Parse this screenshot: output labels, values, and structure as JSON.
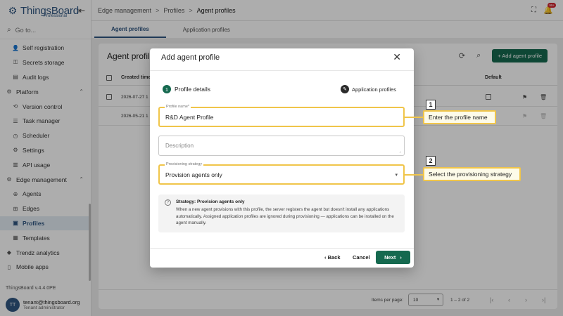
{
  "brand": {
    "name": "ThingsBoard",
    "sub": "Professional"
  },
  "search": {
    "placeholder": "Go to..."
  },
  "sidebar": {
    "items": [
      {
        "label": "Self registration",
        "icon": "person-add-icon"
      },
      {
        "label": "Secrets storage",
        "icon": "key-icon"
      },
      {
        "label": "Audit logs",
        "icon": "audit-icon"
      },
      {
        "label": "Platform",
        "icon": "platform-icon",
        "section": true,
        "expanded": true
      },
      {
        "label": "Version control",
        "icon": "history-icon"
      },
      {
        "label": "Task manager",
        "icon": "list-icon"
      },
      {
        "label": "Scheduler",
        "icon": "clock-icon"
      },
      {
        "label": "Settings",
        "icon": "gear-icon"
      },
      {
        "label": "API usage",
        "icon": "chart-icon"
      },
      {
        "label": "Edge management",
        "icon": "edge-icon",
        "section": true,
        "expanded": true
      },
      {
        "label": "Agents",
        "icon": "globe-icon"
      },
      {
        "label": "Edges",
        "icon": "edges-icon"
      },
      {
        "label": "Profiles",
        "icon": "profile-icon",
        "active": true
      },
      {
        "label": "Templates",
        "icon": "template-icon"
      },
      {
        "label": "Trendz analytics",
        "icon": "trendz-icon",
        "section": true
      },
      {
        "label": "Mobile apps",
        "icon": "mobile-icon",
        "section": true
      }
    ],
    "version": "ThingsBoard v.4.4.0PE",
    "user": {
      "initials": "TT",
      "email": "tenant@thingsboard.org",
      "role": "Tenant administrator"
    }
  },
  "breadcrumb": [
    "Edge management",
    "Profiles",
    "Agent profiles"
  ],
  "notifications_badge": "99+",
  "tabs": [
    "Agent profiles",
    "Application profiles"
  ],
  "table": {
    "title": "Agent profiles",
    "add_label": "+ Add agent profile",
    "headers": {
      "created": "Created time",
      "default": "Default"
    },
    "rows": [
      {
        "created": "2026-07-27 1"
      },
      {
        "created": "2026-05-21 1"
      }
    ],
    "items_per_page_label": "Items per page:",
    "items_per_page": "10",
    "range": "1 – 2 of 2"
  },
  "dialog": {
    "title": "Add agent profile",
    "step1": {
      "num": "1",
      "label": "Profile details"
    },
    "step2": {
      "label": "Application profiles"
    },
    "name_field": {
      "label": "Profile name*",
      "value": "R&D Agent Profile"
    },
    "description_field": {
      "placeholder": "Description"
    },
    "strategy_field": {
      "label": "Provisioning strategy",
      "value": "Provision agents only"
    },
    "info": {
      "title": "Strategy: Provision agents only",
      "text": "When a new agent provisions with this profile, the server registers the agent but doesn't install any applications automatically. Assigned application profiles are ignored during provisioning — applications can be installed on the agent manually."
    },
    "back_label": "Back",
    "cancel_label": "Cancel",
    "next_label": "Next"
  },
  "callouts": [
    {
      "num": "1",
      "text": "Enter the profile name"
    },
    {
      "num": "2",
      "text": "Select the provisioning strategy"
    }
  ],
  "colors": {
    "primary": "#15694f",
    "brand": "#305680",
    "highlight": "#f0c54a"
  }
}
